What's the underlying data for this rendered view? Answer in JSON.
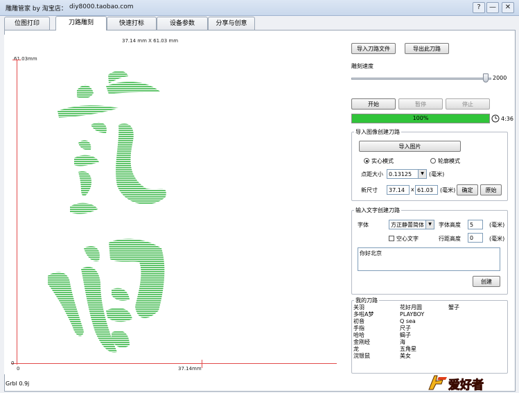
{
  "window": {
    "title": "雕雕管家 by 淘宝店：",
    "shop_domain": "diy8000.taobao.com",
    "controls": {
      "help": "?",
      "minimize": "—",
      "close": "✕"
    }
  },
  "tabs": [
    {
      "label": "位图打印"
    },
    {
      "label": "刀路雕刻"
    },
    {
      "label": "快速打标"
    },
    {
      "label": "设备参数"
    },
    {
      "label": "分享与创意"
    }
  ],
  "canvas": {
    "dimension_label": "37.14 mm X 61.03 mm",
    "top_label": "61.03mm",
    "width_label": "37.14mm",
    "origin_y": "0",
    "origin_x": "0",
    "fill_color": "#5fc46a",
    "axis_color": "#e24a4a"
  },
  "toolpath": {
    "import_button": "导入刀路文件",
    "export_button": "导出此刀路",
    "speed_label": "雕刻速度",
    "speed_value": "2000",
    "speed_fraction": 0.97
  },
  "run": {
    "start_button": "开始",
    "pause_button": "暂停",
    "stop_button": "停止",
    "progress_text": "100%",
    "progress_fraction": 1.0,
    "elapsed_time": "4:36",
    "progress_color": "#31c43a"
  },
  "image_group": {
    "title": "导入图像创建刀路",
    "import_button": "导入图片",
    "mode_solid": "实心模式",
    "mode_outline": "轮廓模式",
    "dot_pitch_label": "点距大小",
    "dot_pitch_value": "0.13125",
    "unit_mm": "(毫米)",
    "new_size_label": "新尺寸",
    "width_value": "37.14",
    "x_label": "x",
    "height_value": "61.03",
    "confirm_button": "确定",
    "original_button": "原始"
  },
  "text_group": {
    "title": "输入文字创建刀路",
    "font_label": "字体",
    "font_value": "方正静蕾简体",
    "font_height_label": "字体高度",
    "font_height_value": "5",
    "unit_mm": "(毫米)",
    "hollow_label": "空心文字",
    "line_height_label": "行距高度",
    "line_height_value": "0",
    "text_value": "你好北京",
    "create_button": "创建"
  },
  "my_paths": {
    "title": "我的刀路",
    "column1": [
      "关羽",
      "多啦A梦",
      "初音",
      "手指",
      "哈哈",
      "金刚经",
      "龙",
      "浣银鼠"
    ],
    "column2": [
      "花好月圆",
      "PLAYBOY",
      "Q sea",
      "尺子",
      "蝎子",
      "海",
      "五角星",
      "美女"
    ],
    "column3": [
      "蟹子"
    ]
  },
  "status": {
    "version": "Grbl 0.9j"
  },
  "watermark": "爱好者"
}
